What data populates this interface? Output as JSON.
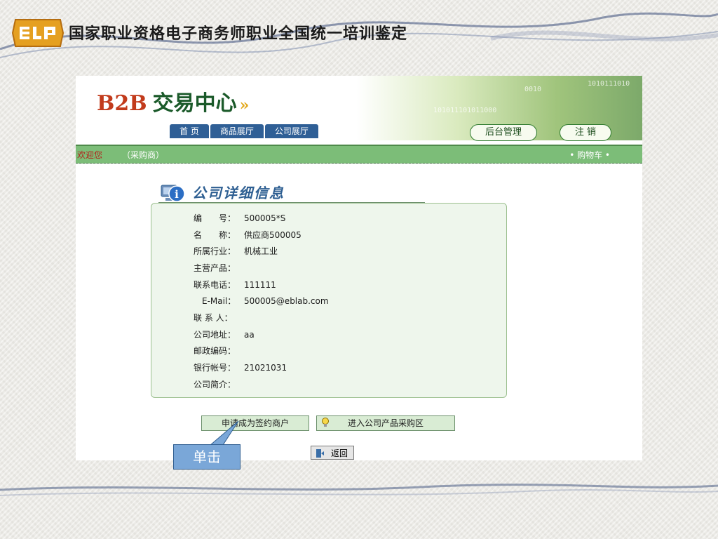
{
  "slide": {
    "title": "国家职业资格电子商务师职业全国统一培训鉴定"
  },
  "app": {
    "brand": {
      "b2b": "B2B",
      "rest": "交易中心"
    },
    "nav": [
      "首 页",
      "商品展厅",
      "公司展厅"
    ],
    "admin_label": "后台管理",
    "logout_label": "注 销",
    "welcome": "欢迎您",
    "role": "（采购商）",
    "cart": "• 购物车 •",
    "section_title": "公司详细信息",
    "fields": [
      {
        "label": "编　　号：",
        "value": "500005*S"
      },
      {
        "label": "名　　称：",
        "value": "供应商500005"
      },
      {
        "label": "所属行业：",
        "value": "机械工业"
      },
      {
        "label": "主营产品：",
        "value": ""
      },
      {
        "label": "联系电话：",
        "value": "111111"
      },
      {
        "label": "　E-Mail：",
        "value": "500005@eblab.com"
      },
      {
        "label": "联 系 人：",
        "value": ""
      },
      {
        "label": "公司地址：",
        "value": "aa"
      },
      {
        "label": "邮政编码：",
        "value": ""
      },
      {
        "label": "银行帐号：",
        "value": "21021031"
      },
      {
        "label": "公司简介：",
        "value": ""
      }
    ],
    "apply_label": "申请成为签约商户",
    "enter_label": "进入公司产品采购区",
    "back_label": "返回"
  },
  "callout": {
    "text": "单击"
  },
  "icons": {
    "logo": "elp-logo",
    "info": "info-computer-icon",
    "bulb": "lightbulb-icon",
    "back": "door-exit-icon"
  }
}
